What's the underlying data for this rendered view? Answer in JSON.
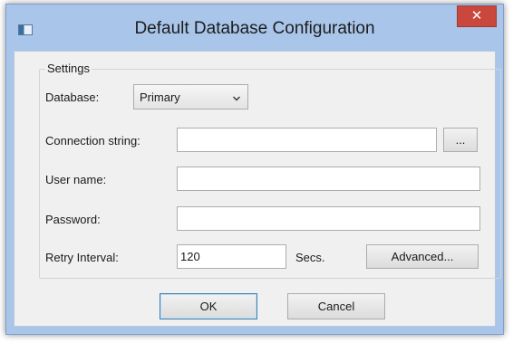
{
  "window": {
    "title": "Default Database Configuration",
    "close_glyph": "✕",
    "app_icon": "database-window-icon"
  },
  "settings": {
    "group_title": "Settings",
    "database_label": "Database:",
    "database_value": "Primary",
    "connection_label": "Connection string:",
    "connection_value": "",
    "browse_label": "...",
    "username_label": "User name:",
    "username_value": "",
    "password_label": "Password:",
    "password_value": "",
    "retry_label": "Retry Interval:",
    "retry_value": "120",
    "retry_unit": "Secs.",
    "advanced_label": "Advanced..."
  },
  "buttons": {
    "ok_label": "OK",
    "cancel_label": "Cancel"
  },
  "colors": {
    "frame": "#a9c6ea",
    "close": "#c9473c",
    "client": "#f0f0f0"
  }
}
